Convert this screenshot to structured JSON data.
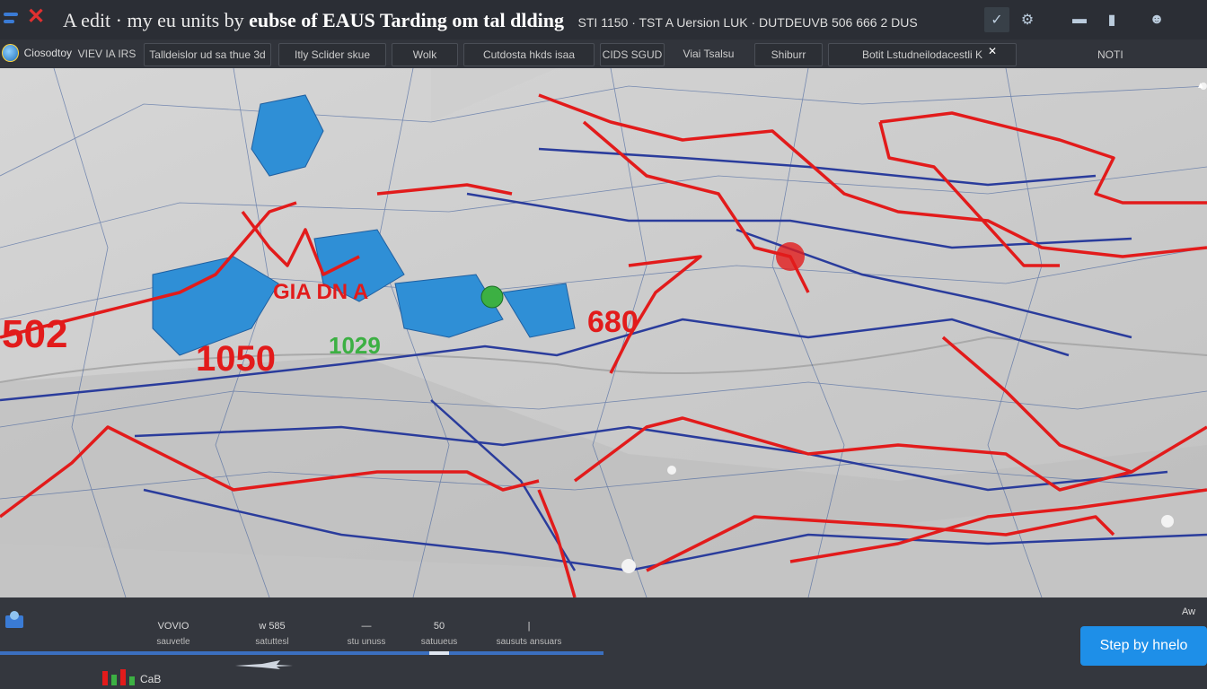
{
  "window": {
    "title_prefix": "A edit · my eu units by",
    "title_bold": "eubse of EAUS Tarding om tal dlding",
    "title_suffix": "STI 1150 · TST A Uersion LUK · DUTDEUVB 506 666 2 DUS"
  },
  "titlebar_icons": [
    "share-icon",
    "settings-icon",
    "window-icon",
    "app-icon",
    "user-icon"
  ],
  "logo": {
    "label": "Ciosodtoy"
  },
  "tabs": [
    {
      "label": "VIEV IA IRS"
    },
    {
      "label": "Talldeislor ud sa thue 3d"
    },
    {
      "label": "Itly Sclider skue"
    },
    {
      "label": "Wolk"
    },
    {
      "label": "Cutdosta hkds isaa"
    },
    {
      "label": "CIDS SGUD"
    },
    {
      "label": "Viai Tsalsu"
    },
    {
      "label": "Shiburr"
    },
    {
      "label": "Botit    Lstudneilodacestli K"
    }
  ],
  "notif_label": "NOTI",
  "map": {
    "values": [
      {
        "text": "502",
        "label": "value-left"
      },
      {
        "text": "1050",
        "label": "value-center"
      },
      {
        "text": "GIA DN A",
        "label": "region-label"
      },
      {
        "text": "680",
        "label": "value-right"
      },
      {
        "text": "1029",
        "label": "value-small"
      }
    ]
  },
  "bottom": {
    "metrics": [
      {
        "top": "VOVIO",
        "bottom": "sauvetle"
      },
      {
        "top": "w 585",
        "bottom": "satuttesl"
      },
      {
        "top": "—",
        "bottom": "stu unuss"
      },
      {
        "top": "50",
        "bottom": "satuueus"
      },
      {
        "top": "|",
        "bottom": "sausuts ansuars"
      }
    ],
    "cta": "Step by hnelo",
    "corner_label": "Aw",
    "tray_label": "CaB"
  },
  "colors": {
    "accent": "#1e8fe8",
    "route_red": "#e21b1b",
    "route_blue": "#2a3c9c"
  }
}
